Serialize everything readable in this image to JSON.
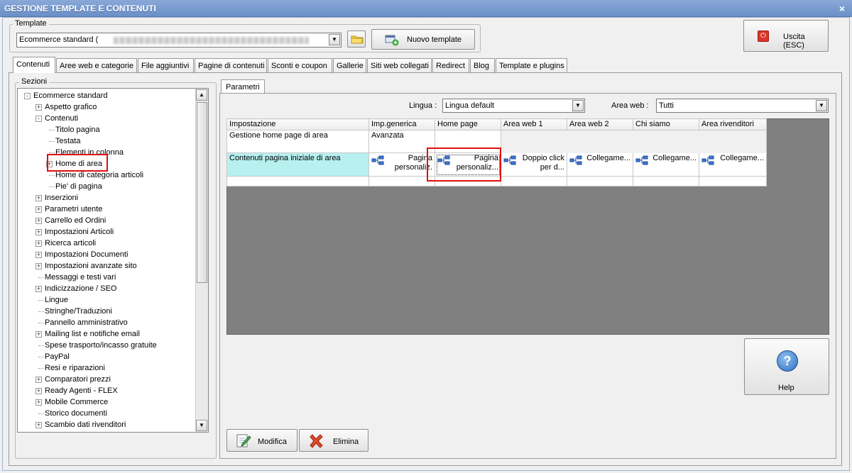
{
  "window": {
    "title": "GESTIONE TEMPLATE E CONTENUTI",
    "close_label": "×"
  },
  "template": {
    "legend": "Template",
    "selected": "Ecommerce standard (",
    "new_template_label": "Nuovo template"
  },
  "exit_label": "Uscita (ESC)",
  "tabs": [
    "Contenuti",
    "Aree web e categorie",
    "File aggiuntivi",
    "Pagine di contenuti",
    "Sconti e coupon",
    "Gallerie",
    "Siti web collegati",
    "Redirect",
    "Blog",
    "Template e plugins"
  ],
  "sections": {
    "legend": "Sezioni",
    "tree": [
      {
        "label": "Ecommerce standard",
        "level": 0,
        "exp": "-"
      },
      {
        "label": "Aspetto grafico",
        "level": 1,
        "exp": "+"
      },
      {
        "label": "Contenuti",
        "level": 1,
        "exp": "-"
      },
      {
        "label": "Titolo pagina",
        "level": 2,
        "exp": ""
      },
      {
        "label": "Testata",
        "level": 2,
        "exp": ""
      },
      {
        "label": "Elementi in colonna",
        "level": 2,
        "exp": ""
      },
      {
        "label": "Home di area",
        "level": 2,
        "exp": "+",
        "selected": true
      },
      {
        "label": "Home di categoria articoli",
        "level": 2,
        "exp": ""
      },
      {
        "label": "Pie' di pagina",
        "level": 2,
        "exp": ""
      },
      {
        "label": "Inserzioni",
        "level": 1,
        "exp": "+"
      },
      {
        "label": "Parametri utente",
        "level": 1,
        "exp": "+"
      },
      {
        "label": "Carrello ed Ordini",
        "level": 1,
        "exp": "+"
      },
      {
        "label": "Impostazioni Articoli",
        "level": 1,
        "exp": "+"
      },
      {
        "label": "Ricerca articoli",
        "level": 1,
        "exp": "+"
      },
      {
        "label": "Impostazioni Documenti",
        "level": 1,
        "exp": "+"
      },
      {
        "label": "Impostazioni avanzate sito",
        "level": 1,
        "exp": "+"
      },
      {
        "label": "Messaggi e testi vari",
        "level": 1,
        "exp": ""
      },
      {
        "label": "Indicizzazione / SEO",
        "level": 1,
        "exp": "+"
      },
      {
        "label": "Lingue",
        "level": 1,
        "exp": ""
      },
      {
        "label": "Stringhe/Traduzioni",
        "level": 1,
        "exp": ""
      },
      {
        "label": "Pannello amministrativo",
        "level": 1,
        "exp": ""
      },
      {
        "label": "Mailing list e notifiche email",
        "level": 1,
        "exp": "+"
      },
      {
        "label": "Spese trasporto/incasso gratuite",
        "level": 1,
        "exp": ""
      },
      {
        "label": "PayPal",
        "level": 1,
        "exp": ""
      },
      {
        "label": "Resi e riparazioni",
        "level": 1,
        "exp": ""
      },
      {
        "label": "Comparatori prezzi",
        "level": 1,
        "exp": "+"
      },
      {
        "label": "Ready Agenti - FLEX",
        "level": 1,
        "exp": "+"
      },
      {
        "label": "Mobile Commerce",
        "level": 1,
        "exp": "+"
      },
      {
        "label": "Storico documenti",
        "level": 1,
        "exp": ""
      },
      {
        "label": "Scambio dati rivenditori",
        "level": 1,
        "exp": "+"
      }
    ]
  },
  "params": {
    "tab": "Parametri",
    "lingua_label": "Lingua :",
    "lingua_value": "Lingua default",
    "area_label": "Area web :",
    "area_value": "Tutti",
    "columns": [
      "Impostazione",
      "Imp.generica",
      "Home page",
      "Area web 1",
      "Area web 2",
      "Chi siamo",
      "Area rivenditori"
    ],
    "row1": {
      "name": "Gestione home page di area",
      "generic": "Avanzata"
    },
    "row2": {
      "name": "Contenuti pagina iniziale di area",
      "cells": [
        "Pagina personaliz.",
        "Pagina personaliz...",
        "Doppio click per d...",
        "Collegame...",
        "Collegame...",
        "Collegame..."
      ]
    }
  },
  "help_label": "Help",
  "modifica_label": "Modifica",
  "elimina_label": "Elimina",
  "colors": {
    "accent": "#6a8fc8",
    "highlight_cyan": "#b8f0f0",
    "grid_bg": "#808080",
    "red_box": "#e01010"
  }
}
